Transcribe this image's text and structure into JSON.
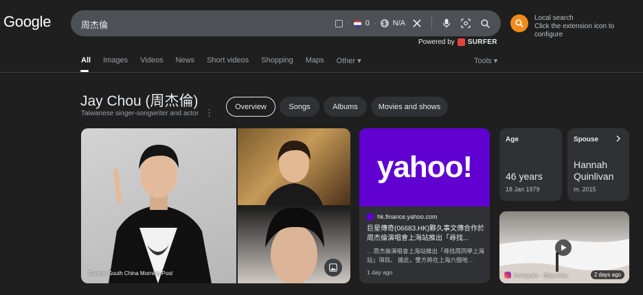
{
  "logo": "Google",
  "search": {
    "query": "周杰倫",
    "counter_value": "0",
    "price_value": "N/A"
  },
  "powered_by": {
    "prefix": "Powered by",
    "brand": "SURFER"
  },
  "extension": {
    "title": "Local search",
    "subtitle": "Click the extension icon to configure"
  },
  "tabs": [
    "All",
    "Images",
    "Videos",
    "News",
    "Short videos",
    "Shopping",
    "Maps",
    "Other ▾"
  ],
  "tools": "Tools ▾",
  "entity": {
    "title": "Jay Chou (周杰倫)",
    "subtitle": "Taiwanese singer-songwriter and actor"
  },
  "pills": [
    "Overview",
    "Songs",
    "Albums",
    "Movies and shows"
  ],
  "images": {
    "caption": "Source: South China Morning Post"
  },
  "news": {
    "banner": "yahoo!",
    "source": "hk.finance.yahoo.com",
    "title": "巨星傳奇(06683.HK)夥久事文傳合作於周杰倫演唱會上海站推出「尋找...",
    "snippet": "... 周杰倫演唱會上海站推出「尋找周同學上海站」項目。 據此，雙方將在上海六個地...",
    "time": "1 day ago"
  },
  "facts": {
    "age": {
      "label": "Age",
      "value": "46 years",
      "sub": "18 Jan 1979"
    },
    "spouse": {
      "label": "Spouse",
      "value_line1": "Hannah",
      "value_line2": "Quinlivan",
      "sub": "m. 2015"
    }
  },
  "video": {
    "source": "Instagram · @jaychou",
    "time": "2 days ago"
  },
  "colors": {
    "background": "#1f1f1f",
    "search_bg": "#4d5156",
    "card_bg": "#303134",
    "extension_accent": "#f28b19",
    "yahoo_purple": "#6001d2"
  }
}
